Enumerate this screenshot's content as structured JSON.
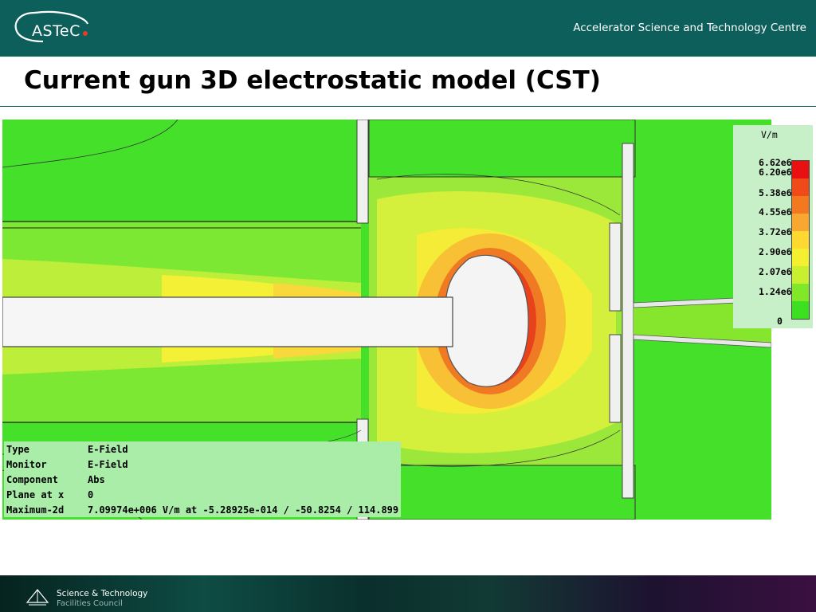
{
  "header": {
    "logo_text": "ASTeC",
    "centre_name": "Accelerator Science and Technology Centre"
  },
  "slide": {
    "title": "Current gun 3D electrostatic model (CST)"
  },
  "legend": {
    "unit": "V/m",
    "labels": [
      "6.62e6",
      "6.20e6",
      "5.38e6",
      "4.55e6",
      "3.72e6",
      "2.90e6",
      "2.07e6",
      "1.24e6",
      "0"
    ],
    "colors": [
      "#e81010",
      "#f04a18",
      "#f47820",
      "#f8a830",
      "#ffd830",
      "#f4f030",
      "#c8f030",
      "#80e828",
      "#3ce020"
    ]
  },
  "info": {
    "rows": [
      {
        "key": "Type",
        "value": "E-Field"
      },
      {
        "key": "Monitor",
        "value": "E-Field"
      },
      {
        "key": "Component",
        "value": "Abs"
      },
      {
        "key": "Plane at x",
        "value": "0"
      },
      {
        "key": "Maximum-2d",
        "value": "7.09974e+006 V/m at -5.28925e-014 / -50.8254 / 114.899"
      }
    ]
  },
  "footer": {
    "org_line1": "Science & Technology",
    "org_line2": "Facilities Council"
  }
}
